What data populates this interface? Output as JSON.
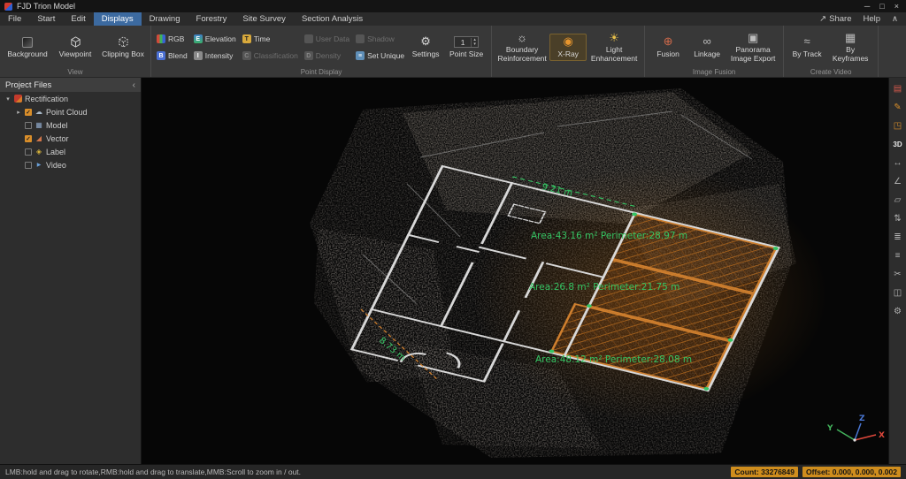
{
  "window": {
    "title": "FJD Trion Model"
  },
  "icons": {
    "minimize": "─",
    "maximize": "□",
    "close": "×",
    "share": "↗",
    "menu_collapse": "∧",
    "expanded_arrow": "▾",
    "collapsed_arrow": "▸",
    "panel_collapse": "‹",
    "check": "✓",
    "spin_up": "▴",
    "spin_down": "▾",
    "settings_gear": "⚙",
    "boundary": "☼",
    "xray": "◉",
    "light": "☀",
    "fusion": "⊕",
    "linkage": "∞",
    "panorama": "▣",
    "by_track": "≈",
    "by_keyframes": "▦",
    "point_cloud": "☁",
    "model": "▦",
    "vector": "◢",
    "label": "◈",
    "video": "▶"
  },
  "menu": {
    "items": [
      "File",
      "Start",
      "Edit",
      "Displays",
      "Drawing",
      "Forestry",
      "Site Survey",
      "Section Analysis"
    ],
    "active": "Displays",
    "share": "Share",
    "help": "Help"
  },
  "ribbon": {
    "view": {
      "label": "View",
      "buttons": [
        {
          "label": "Background"
        },
        {
          "label": "Viewpoint"
        },
        {
          "label": "Clipping Box"
        }
      ]
    },
    "point_display": {
      "label": "Point Display",
      "buttons": [
        {
          "label": "RGB",
          "ic": "",
          "enabled": true
        },
        {
          "label": "Blend",
          "ic": "B",
          "enabled": true
        },
        {
          "label": "Elevation",
          "ic": "E",
          "enabled": true
        },
        {
          "label": "Intensity",
          "ic": "I",
          "enabled": true
        },
        {
          "label": "Time",
          "ic": "T",
          "enabled": true
        },
        {
          "label": "Classification",
          "ic": "C",
          "enabled": false
        },
        {
          "label": "User Data",
          "ic": "",
          "enabled": false
        },
        {
          "label": "Density",
          "ic": "D",
          "enabled": false
        },
        {
          "label": "Shadow",
          "ic": "",
          "enabled": false
        },
        {
          "label": "Set Unique",
          "ic": "≡",
          "enabled": true
        }
      ],
      "settings_label": "Settings",
      "point_size": {
        "value": "1",
        "label": "Point Size"
      }
    },
    "enhance": {
      "buttons": [
        {
          "label": "Boundary Reinforcement",
          "active": false
        },
        {
          "label": "X-Ray",
          "active": true
        },
        {
          "label": "Light Enhancement",
          "active": false
        }
      ]
    },
    "image_fusion": {
      "label": "Image Fusion",
      "buttons": [
        {
          "label": "Fusion"
        },
        {
          "label": "Linkage"
        },
        {
          "label": "Panorama Image Export"
        }
      ]
    },
    "create_video": {
      "label": "Create Video",
      "buttons": [
        {
          "label": "By Track"
        },
        {
          "label": "By Keyframes"
        }
      ]
    }
  },
  "sidebar": {
    "title": "Project Files",
    "items": [
      {
        "label": "Rectification",
        "checked": null
      },
      {
        "label": "Point Cloud",
        "checked": true
      },
      {
        "label": "Model",
        "checked": false
      },
      {
        "label": "Vector",
        "checked": true
      },
      {
        "label": "Label",
        "checked": false
      },
      {
        "label": "Video",
        "checked": false
      }
    ]
  },
  "viewport": {
    "measurements": [
      "9.21 m",
      "Area:43.16 m² Perimeter:28.97 m",
      "Area:26.8 m² Perimeter:21.75 m",
      "Area:48.12 m² Perimeter:28.08 m",
      "8.73 m"
    ],
    "axis": {
      "x": "X",
      "y": "Y",
      "z": "Z"
    }
  },
  "rail": {
    "icons": [
      {
        "name": "panel-list-icon",
        "glyph": "▤"
      },
      {
        "name": "annotate-icon",
        "glyph": "✎"
      },
      {
        "name": "export-icon",
        "glyph": "◳"
      },
      {
        "name": "3d-view-icon",
        "glyph": "3D"
      },
      {
        "name": "measure-distance-icon",
        "glyph": "↔"
      },
      {
        "name": "measure-angle-icon",
        "glyph": "∠"
      },
      {
        "name": "measure-area-icon",
        "glyph": "▱"
      },
      {
        "name": "measure-height-icon",
        "glyph": "⇅"
      },
      {
        "name": "annotation-list-icon",
        "glyph": "≣"
      },
      {
        "name": "layers-icon",
        "glyph": "≡"
      },
      {
        "name": "clip-icon",
        "glyph": "✂"
      },
      {
        "name": "compare-icon",
        "glyph": "◫"
      },
      {
        "name": "settings-icon",
        "glyph": "⚙"
      }
    ]
  },
  "status": {
    "hint": "LMB:hold and drag to rotate,RMB:hold and drag to translate,MMB:Scroll to zoom in / out.",
    "count": "Count: 33276849",
    "offset": "Offset: 0.000, 0.000, 0.002"
  }
}
